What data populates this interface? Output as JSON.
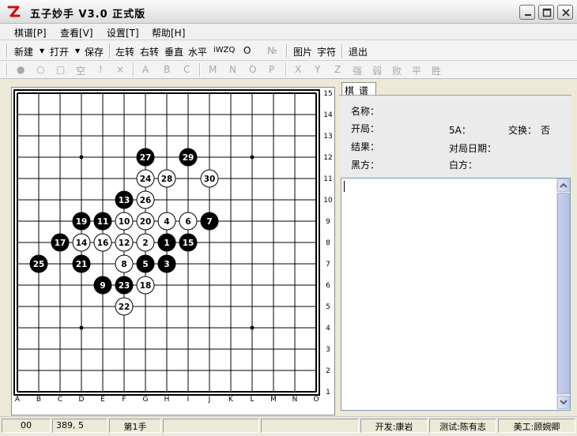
{
  "window": {
    "title": "五子妙手  V3.0  正式版",
    "icon": "logo-icon",
    "buttons": [
      "minimize-icon",
      "maximize-icon",
      "close-icon"
    ]
  },
  "menu": [
    "棋谱[P]",
    "查看[V]",
    "设置[T]",
    "帮助[H]"
  ],
  "toolbar1": {
    "new": "新建",
    "open": "打开",
    "save": "保存",
    "rotate_left": "左转",
    "rotate_right": "右转",
    "vertical": "垂直",
    "horizontal": "水平",
    "iwzq": "iWZQ",
    "circle": "O",
    "number": "№",
    "picture": "图片",
    "chars": "字符",
    "exit": "退出"
  },
  "toolbar2": {
    "items": [
      "●",
      "○",
      "□",
      "空",
      "!",
      "×",
      "A",
      "B",
      "C",
      "M",
      "N",
      "O",
      "P",
      "X",
      "Y",
      "Z",
      "强",
      "弱",
      "败",
      "平",
      "胜"
    ]
  },
  "board": {
    "size": 15,
    "col_labels": [
      "A",
      "B",
      "C",
      "D",
      "E",
      "F",
      "G",
      "H",
      "I",
      "J",
      "K",
      "L",
      "M",
      "N",
      "O"
    ],
    "row_labels": [
      "15",
      "14",
      "13",
      "12",
      "11",
      "10",
      "9",
      "8",
      "7",
      "6",
      "5",
      "4",
      "3",
      "2",
      "1"
    ],
    "star_points": [
      [
        3,
        3
      ],
      [
        11,
        3
      ],
      [
        3,
        11
      ],
      [
        11,
        11
      ]
    ],
    "moves": [
      {
        "n": 1,
        "col": 7,
        "row": 7
      },
      {
        "n": 2,
        "col": 6,
        "row": 7
      },
      {
        "n": 3,
        "col": 7,
        "row": 8
      },
      {
        "n": 4,
        "col": 7,
        "row": 6
      },
      {
        "n": 5,
        "col": 6,
        "row": 8
      },
      {
        "n": 6,
        "col": 8,
        "row": 6
      },
      {
        "n": 7,
        "col": 9,
        "row": 6
      },
      {
        "n": 8,
        "col": 5,
        "row": 8
      },
      {
        "n": 9,
        "col": 4,
        "row": 9
      },
      {
        "n": 10,
        "col": 5,
        "row": 6
      },
      {
        "n": 11,
        "col": 4,
        "row": 6
      },
      {
        "n": 12,
        "col": 5,
        "row": 7
      },
      {
        "n": 13,
        "col": 5,
        "row": 5
      },
      {
        "n": 14,
        "col": 3,
        "row": 7
      },
      {
        "n": 15,
        "col": 8,
        "row": 7
      },
      {
        "n": 16,
        "col": 4,
        "row": 7
      },
      {
        "n": 17,
        "col": 2,
        "row": 7
      },
      {
        "n": 18,
        "col": 6,
        "row": 9
      },
      {
        "n": 19,
        "col": 3,
        "row": 6
      },
      {
        "n": 20,
        "col": 6,
        "row": 6
      },
      {
        "n": 21,
        "col": 3,
        "row": 8
      },
      {
        "n": 22,
        "col": 5,
        "row": 10
      },
      {
        "n": 23,
        "col": 5,
        "row": 9
      },
      {
        "n": 24,
        "col": 6,
        "row": 4
      },
      {
        "n": 25,
        "col": 1,
        "row": 8
      },
      {
        "n": 26,
        "col": 6,
        "row": 5
      },
      {
        "n": 27,
        "col": 6,
        "row": 3
      },
      {
        "n": 28,
        "col": 7,
        "row": 4
      },
      {
        "n": 29,
        "col": 8,
        "row": 3
      },
      {
        "n": 30,
        "col": 9,
        "row": 4
      }
    ]
  },
  "panel": {
    "tab": "棋谱",
    "name_label": "名称：",
    "opening_label": "开局：",
    "five_a_label": "5A：",
    "swap_label": "交换：",
    "swap_value": "否",
    "result_label": "结果：",
    "date_label": "对局日期：",
    "black_label": "黑方：",
    "white_label": "白方："
  },
  "status": {
    "cell1": "00",
    "cell2": "389, 5",
    "cell3": "第1手",
    "cell4": "",
    "cell5": "",
    "developer": "开发:康岩",
    "tester": "测试:陈有志",
    "artist": "美工:顾婉卿"
  }
}
